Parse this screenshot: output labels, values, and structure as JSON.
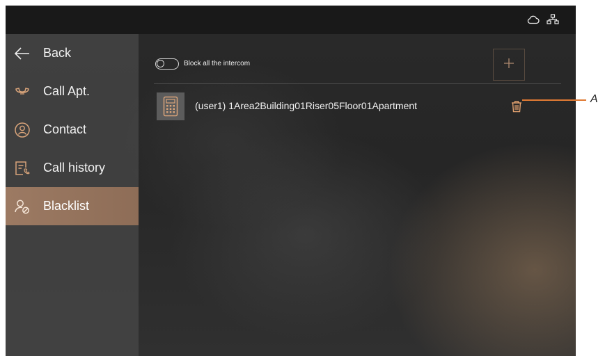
{
  "sidebar": {
    "items": [
      {
        "label": "Back",
        "icon": "back-arrow-icon"
      },
      {
        "label": "Call Apt.",
        "icon": "phone-handset-icon"
      },
      {
        "label": "Contact",
        "icon": "contact-person-icon"
      },
      {
        "label": "Call history",
        "icon": "call-history-icon"
      },
      {
        "label": "Blacklist",
        "icon": "blacklist-user-icon"
      }
    ]
  },
  "toolbar": {
    "toggle_label": "Block all the intercom",
    "toggle_state": "off",
    "add_icon": "plus-icon"
  },
  "blacklist": {
    "entries": [
      {
        "name": "(user1) 1Area2Building01Riser05Floor01Apartment",
        "icon": "door-station-icon",
        "action_icon": "trash-icon"
      }
    ]
  },
  "callout": {
    "label": "A"
  },
  "colors": {
    "accent": "#d9a47a",
    "active_bg": "#9c7a63",
    "callout": "#e07a33"
  }
}
